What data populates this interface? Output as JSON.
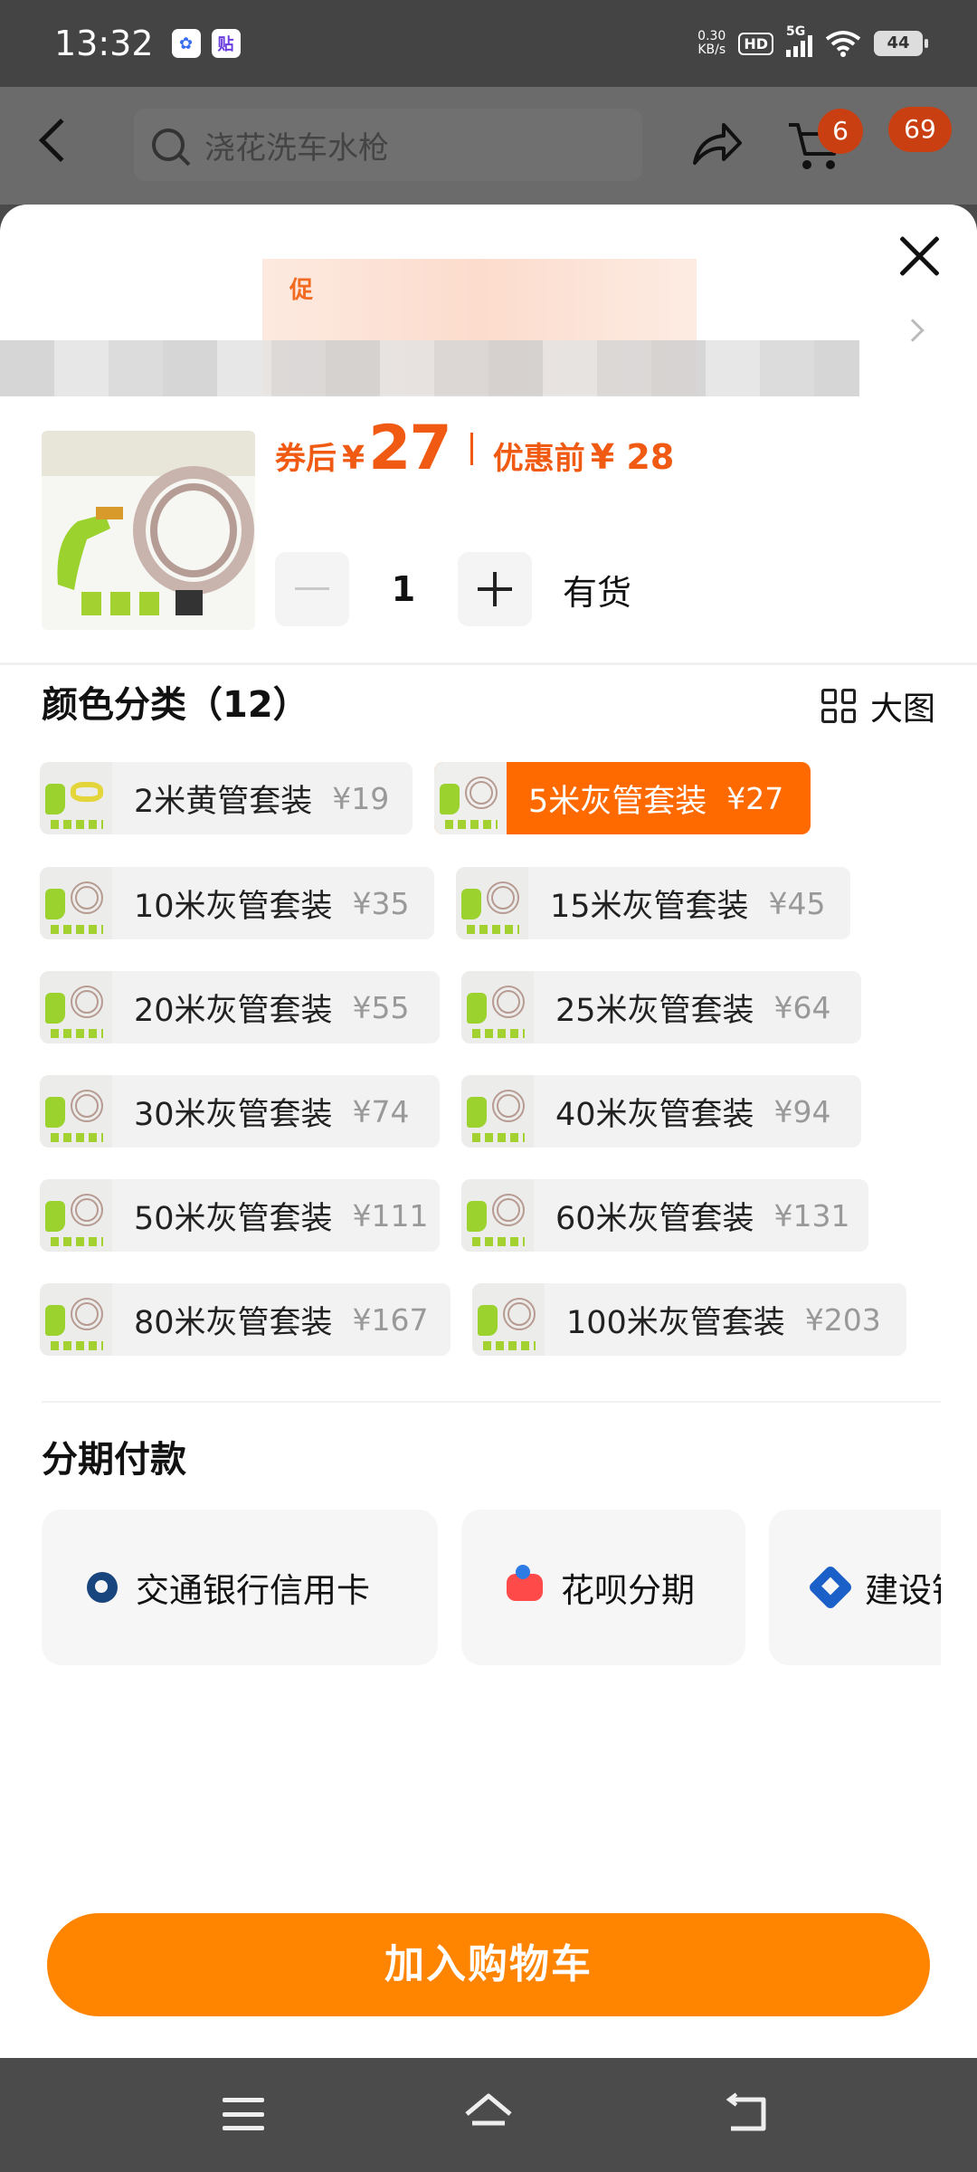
{
  "status_bar": {
    "time": "13:32",
    "app_icon_1": "baidu-icon",
    "app_icon_2": "tieba-icon",
    "net_speed_value": "0.30",
    "net_speed_unit": "KB/s",
    "hd_label": "HD",
    "network_label": "5G",
    "battery_level": "44"
  },
  "header": {
    "search_placeholder": "浇花洗车水枪",
    "cart_badge": "6",
    "message_badge": "69"
  },
  "product": {
    "price_label": "券后",
    "currency": "¥",
    "price": "27",
    "original_label": "优惠前",
    "original_price": "¥ 28",
    "quantity": "1",
    "stock": "有货"
  },
  "colors": {
    "title": "颜色分类（12）",
    "big_view_label": "大图",
    "accent": "#ff6a00",
    "items": [
      {
        "name": "2米黄管套装",
        "price": "¥19"
      },
      {
        "name": "5米灰管套装",
        "price": "¥27"
      },
      {
        "name": "10米灰管套装",
        "price": "¥35"
      },
      {
        "name": "15米灰管套装",
        "price": "¥45"
      },
      {
        "name": "20米灰管套装",
        "price": "¥55"
      },
      {
        "name": "25米灰管套装",
        "price": "¥64"
      },
      {
        "name": "30米灰管套装",
        "price": "¥74"
      },
      {
        "name": "40米灰管套装",
        "price": "¥94"
      },
      {
        "name": "50米灰管套装",
        "price": "¥111"
      },
      {
        "name": "60米灰管套装",
        "price": "¥131"
      },
      {
        "name": "80米灰管套装",
        "price": "¥167"
      },
      {
        "name": "100米灰管套装",
        "price": "¥203"
      }
    ]
  },
  "installment": {
    "title": "分期付款",
    "options": [
      {
        "label": "交通银行信用卡"
      },
      {
        "label": "花呗分期"
      },
      {
        "label": "建设银行信用卡"
      }
    ]
  },
  "footer": {
    "add_to_cart": "加入购物车",
    "button_color": "#ff8400"
  }
}
